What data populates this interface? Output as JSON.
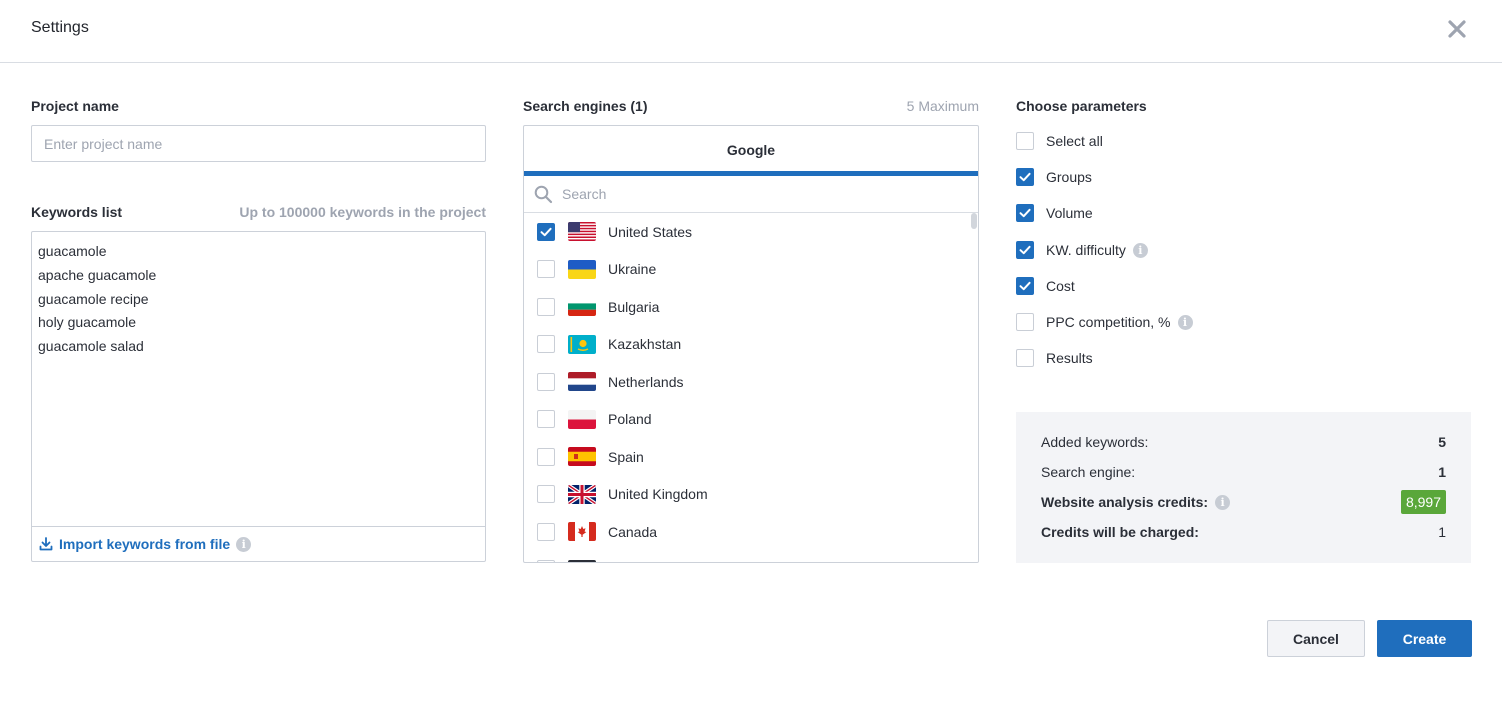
{
  "dialog": {
    "title": "Settings",
    "close_icon": "close-icon"
  },
  "project": {
    "label": "Project name",
    "placeholder": "Enter project name",
    "value": ""
  },
  "keywords": {
    "label": "Keywords list",
    "limit_hint": "Up to 100000 keywords in the project",
    "items": [
      "guacamole",
      "apache guacamole",
      "guacamole recipe",
      "holy guacamole",
      "guacamole salad"
    ],
    "import_label": "Import keywords from file",
    "import_icon": "download-icon"
  },
  "search_engines": {
    "label": "Search engines (1)",
    "max_hint": "5 Maximum",
    "active_tab": "Google",
    "search_placeholder": "Search",
    "countries": [
      {
        "name": "United States",
        "checked": true,
        "flag": "us-flag-icon"
      },
      {
        "name": "Ukraine",
        "checked": false,
        "flag": "ua-flag-icon"
      },
      {
        "name": "Bulgaria",
        "checked": false,
        "flag": "bg-flag-icon"
      },
      {
        "name": "Kazakhstan",
        "checked": false,
        "flag": "kz-flag-icon"
      },
      {
        "name": "Netherlands",
        "checked": false,
        "flag": "nl-flag-icon"
      },
      {
        "name": "Poland",
        "checked": false,
        "flag": "pl-flag-icon"
      },
      {
        "name": "Spain",
        "checked": false,
        "flag": "es-flag-icon"
      },
      {
        "name": "United Kingdom",
        "checked": false,
        "flag": "gb-flag-icon"
      },
      {
        "name": "Canada",
        "checked": false,
        "flag": "ca-flag-icon"
      }
    ]
  },
  "parameters": {
    "label": "Choose parameters",
    "items": [
      {
        "label": "Select all",
        "checked": false,
        "info": false
      },
      {
        "label": "Groups",
        "checked": true,
        "info": false
      },
      {
        "label": "Volume",
        "checked": true,
        "info": false
      },
      {
        "label": "KW. difficulty",
        "checked": true,
        "info": true
      },
      {
        "label": "Cost",
        "checked": true,
        "info": false
      },
      {
        "label": "PPC competition, %",
        "checked": false,
        "info": true
      },
      {
        "label": "Results",
        "checked": false,
        "info": false
      }
    ]
  },
  "summary": {
    "added_keywords_label": "Added keywords:",
    "added_keywords_value": "5",
    "search_engine_label": "Search engine:",
    "search_engine_value": "1",
    "credits_label": "Website analysis credits:",
    "credits_value": "8,997",
    "charged_label": "Credits will be charged:",
    "charged_value": "1"
  },
  "buttons": {
    "cancel": "Cancel",
    "create": "Create"
  },
  "colors": {
    "accent": "#1f6ebd",
    "credit_badge": "#5aa73a",
    "summary_bg": "#f3f4f7"
  }
}
